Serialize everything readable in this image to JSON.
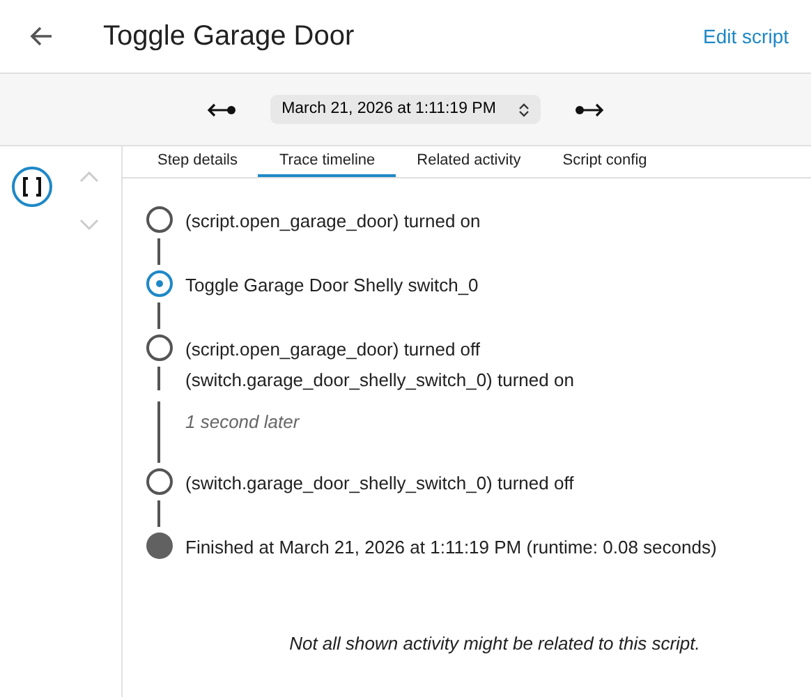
{
  "header": {
    "title": "Toggle Garage Door",
    "action": "Edit script"
  },
  "trace_picker": {
    "value": "March 21, 2026 at 1:11:19 PM"
  },
  "step_nav": [
    {
      "kind": "up",
      "disabled": true
    },
    {
      "kind": "down",
      "disabled": true
    }
  ],
  "tabs": [
    {
      "label": "Step details",
      "selected": false
    },
    {
      "label": "Trace timeline",
      "selected": true
    },
    {
      "label": "Related activity",
      "selected": false
    },
    {
      "label": "Script config",
      "selected": false
    }
  ],
  "timeline": [
    {
      "kind": "event",
      "lines": [
        "(script.open_garage_door) turned on"
      ]
    },
    {
      "kind": "step",
      "lines": [
        "Toggle Garage Door Shelly switch_0"
      ]
    },
    {
      "kind": "event",
      "lines": [
        "(script.open_garage_door) turned off",
        "(switch.garage_door_shelly_switch_0) turned on"
      ]
    },
    {
      "kind": "gap",
      "lines": [
        "1 second later"
      ]
    },
    {
      "kind": "event",
      "lines": [
        "(switch.garage_door_shelly_switch_0) turned off"
      ]
    },
    {
      "kind": "finish",
      "lines": [
        "Finished at March 21, 2026 at 1:11:19 PM (runtime: 0.08 seconds)"
      ]
    }
  ],
  "note": "Not all shown activity might be related to this script."
}
